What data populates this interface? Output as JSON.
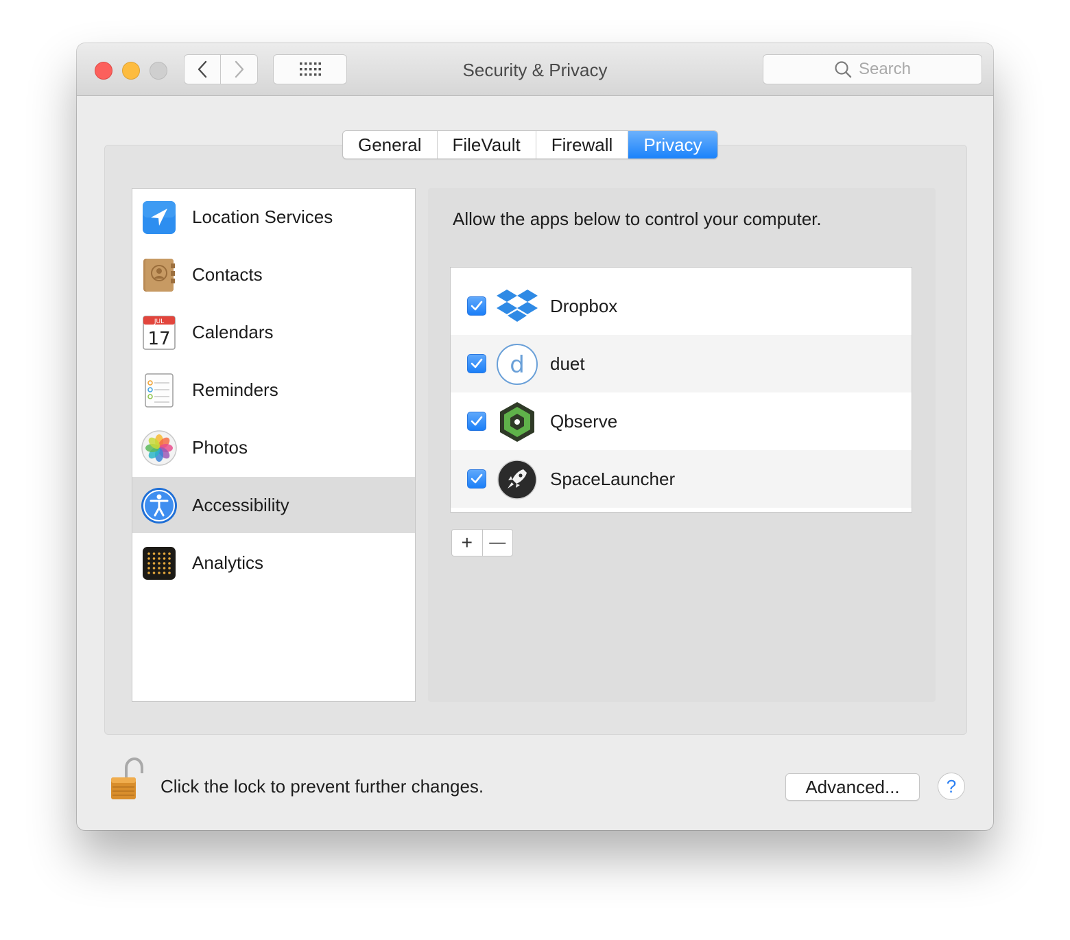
{
  "window": {
    "title": "Security & Privacy",
    "search_placeholder": "Search"
  },
  "tabs": [
    {
      "label": "General",
      "active": false
    },
    {
      "label": "FileVault",
      "active": false
    },
    {
      "label": "Firewall",
      "active": false
    },
    {
      "label": "Privacy",
      "active": true
    }
  ],
  "sidebar": {
    "items": [
      {
        "label": "Location Services",
        "icon": "location-arrow-icon",
        "selected": false
      },
      {
        "label": "Contacts",
        "icon": "contacts-book-icon",
        "selected": false
      },
      {
        "label": "Calendars",
        "icon": "calendar-icon",
        "selected": false,
        "icon_month": "JUL",
        "icon_day": "17"
      },
      {
        "label": "Reminders",
        "icon": "reminders-list-icon",
        "selected": false
      },
      {
        "label": "Photos",
        "icon": "photos-flower-icon",
        "selected": false
      },
      {
        "label": "Accessibility",
        "icon": "accessibility-figure-icon",
        "selected": true
      },
      {
        "label": "Analytics",
        "icon": "analytics-dots-icon",
        "selected": false
      }
    ]
  },
  "main": {
    "instruction": "Allow the apps below to control your computer.",
    "apps": [
      {
        "name": "Dropbox",
        "checked": true,
        "icon": "dropbox-icon"
      },
      {
        "name": "duet",
        "checked": true,
        "icon": "duet-icon",
        "icon_letter": "d"
      },
      {
        "name": "Qbserve",
        "checked": true,
        "icon": "qbserve-icon"
      },
      {
        "name": "SpaceLauncher",
        "checked": true,
        "icon": "spacelauncher-rocket-icon"
      }
    ],
    "add_label": "+",
    "remove_label": "—"
  },
  "footer": {
    "lock_text": "Click the lock to prevent further changes.",
    "advanced_label": "Advanced...",
    "help_label": "?"
  },
  "colors": {
    "accent": "#1a82fb",
    "selection": "#dcdcdc",
    "close": "#fc605c",
    "minimize": "#fdbc40"
  }
}
